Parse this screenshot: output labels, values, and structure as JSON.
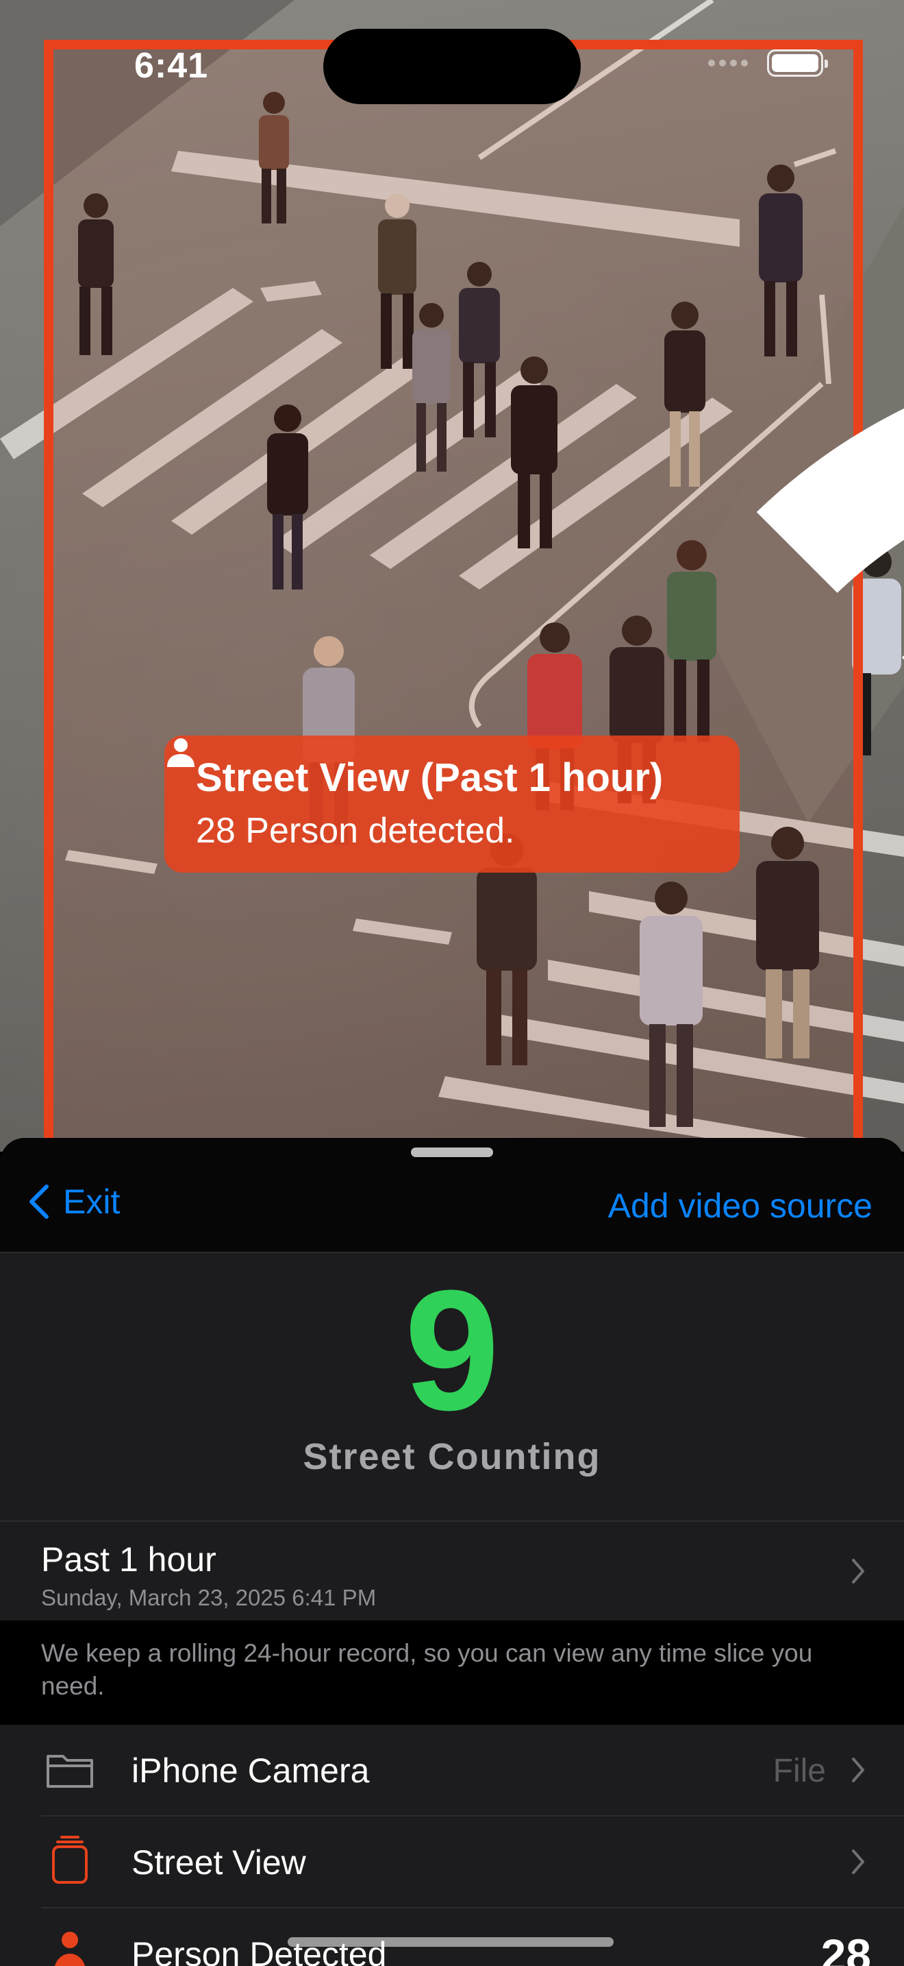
{
  "status_bar": {
    "time": "6:41"
  },
  "video": {
    "detection_card": {
      "title": "Street View (Past 1 hour)",
      "count_text": "28 Person detected."
    },
    "frame_color": "#e8421c"
  },
  "sheet": {
    "exit_label": "Exit",
    "add_source_label": "Add video source",
    "counter": {
      "value": "9",
      "name": "Street Counting",
      "color": "#30d158"
    },
    "time_range": {
      "title": "Past 1 hour",
      "subtitle": "Sunday, March 23, 2025 6:41 PM"
    },
    "note": "We keep a rolling 24-hour record, so you can view any time slice you need.",
    "items": [
      {
        "label": "iPhone Camera",
        "detail": "File",
        "icon": "folder-icon"
      },
      {
        "label": "Street View",
        "detail": "",
        "icon": "camera-stack-icon"
      },
      {
        "label": "Person Detected",
        "value": "28",
        "icon": "person-icon"
      }
    ]
  },
  "colors": {
    "accent": "#0a84ff",
    "detection": "#e8421c",
    "count": "#30d158"
  }
}
